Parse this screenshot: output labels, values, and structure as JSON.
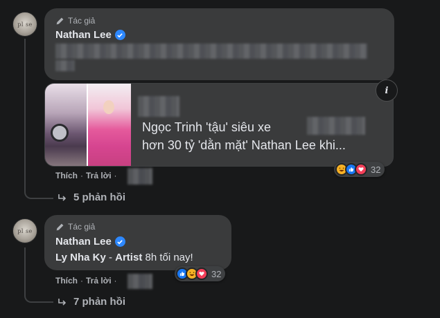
{
  "comment1": {
    "badge": "Tác giả",
    "author": "Nathan Lee",
    "link_title_line1": "Ngọc Trinh 'tậu' siêu xe",
    "link_title_line2": "hơn 30 tỷ 'dằn mặt' Nathan Lee khi...",
    "info_label": "i",
    "like_label": "Thích",
    "reply_label": "Trả lời",
    "separator": "·",
    "reaction_count": "32",
    "replies_label": "5 phản hồi",
    "reaction_icons": [
      "haha-icon",
      "like-icon",
      "love-icon"
    ]
  },
  "comment2": {
    "badge": "Tác giả",
    "author": "Nathan Lee",
    "text_bold1": "Ly Nha Ky",
    "text_sep": " - ",
    "text_bold2": "Artist",
    "text_rest": " 8h tối nay!",
    "like_label": "Thích",
    "reply_label": "Trả lời",
    "separator": "·",
    "reaction_count": "32",
    "replies_label": "7 phản hồi",
    "reaction_icons": [
      "like-icon",
      "haha-icon",
      "love-icon"
    ]
  },
  "colors": {
    "background": "#18191a",
    "bubble": "#3a3b3c",
    "verified": "#2d88ff",
    "like": "#1877f2",
    "love": "#f33e58",
    "haha": "#f7b125"
  }
}
